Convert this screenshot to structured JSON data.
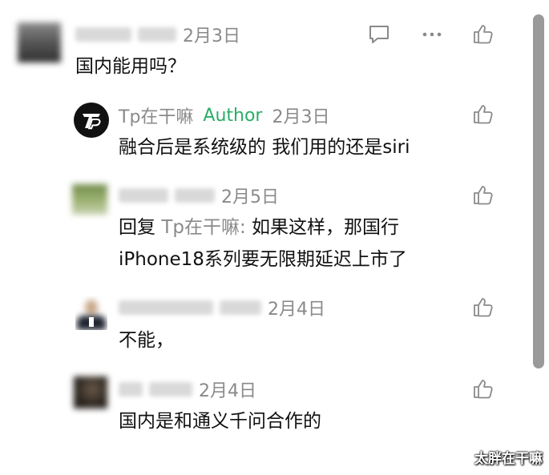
{
  "comments": [
    {
      "name": "",
      "date": "2月3日",
      "text": "国内能用吗？",
      "has_comment_icon": true
    },
    {
      "name": "Tp在干嘛",
      "badge": "Author",
      "date": "2月3日",
      "text": "融合后是系统级的 我们用的还是siri"
    },
    {
      "name": "",
      "date": "2月5日",
      "reply_prefix": "回复 ",
      "reply_to": "Tp在干嘛:",
      "text_line1": " 如果这样，那国行",
      "text_line2": "iPhone18系列要无限期延迟上市了"
    },
    {
      "name": "",
      "date": "2月4日",
      "text": "不能，"
    },
    {
      "name": "",
      "date": "2月4日",
      "text": "国内是和通义千问合作的"
    }
  ],
  "watermark": "太胖在干嘛",
  "colors": {
    "author": "#2aae67",
    "meta": "#8a8a8a",
    "scrollbar": "#9a9a9a"
  },
  "icons": [
    "comment-icon",
    "more-icon",
    "thumbs-up-icon"
  ]
}
